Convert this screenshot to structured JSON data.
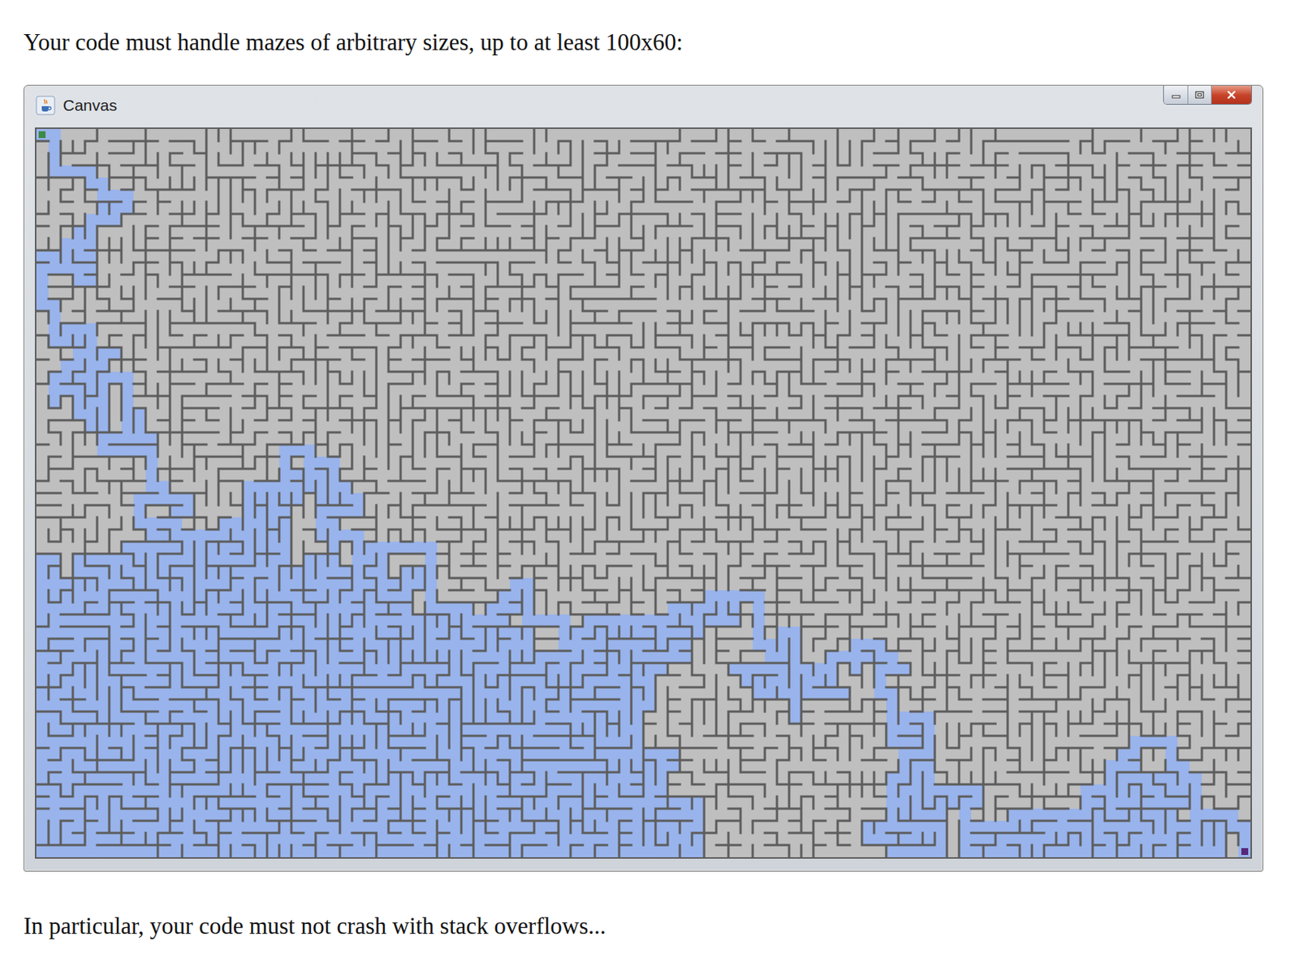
{
  "document": {
    "intro": "Your code must handle mazes of arbitrary sizes, up to at least 100x60:",
    "outro": "In particular, your code must not crash with stack overflows..."
  },
  "window": {
    "title": "Canvas"
  },
  "maze": {
    "columns": 100,
    "rows": 60,
    "seed": 20240601,
    "explored_color": "#99b4ec",
    "markers": [
      {
        "name": "start",
        "color": "#3d8a45"
      },
      {
        "name": "end",
        "color": "#55287a"
      }
    ]
  }
}
